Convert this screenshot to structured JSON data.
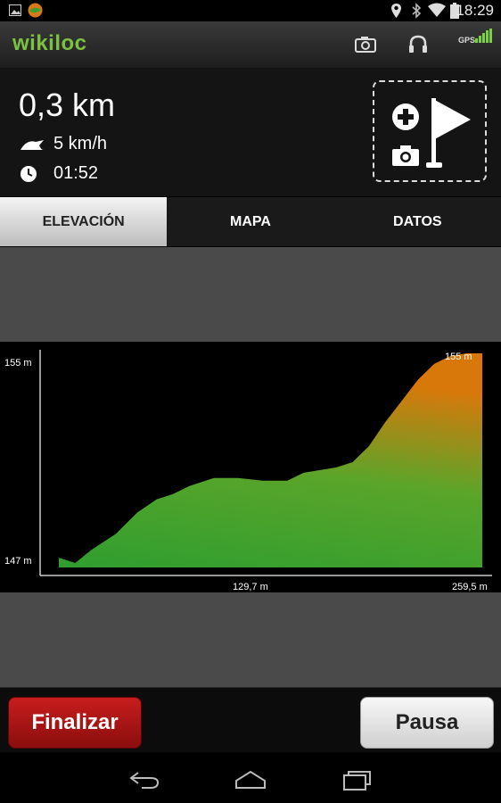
{
  "status_bar": {
    "time": "18:29"
  },
  "app_bar": {
    "logo": "wikiloc",
    "gps_label": "GPS",
    "icons": [
      "camera-icon",
      "headphones-icon",
      "gps-signal-icon"
    ]
  },
  "stats": {
    "distance": "0,3 km",
    "speed": "5 km/h",
    "time": "01:52",
    "add_waypoint_icons": [
      "plus-icon",
      "camera-icon",
      "flag-icon"
    ]
  },
  "tabs": [
    {
      "label": "ELEVACIÓN",
      "active": true
    },
    {
      "label": "MAPA",
      "active": false
    },
    {
      "label": "DATOS",
      "active": false
    }
  ],
  "chart_data": {
    "type": "area",
    "y_tick_labels": [
      "155 m",
      "147 m"
    ],
    "x_tick_labels": [
      "129,7 m",
      "259,5 m"
    ],
    "max_label": "155 m",
    "ylim": [
      147,
      155
    ],
    "xlim": [
      0,
      259.5
    ],
    "x": [
      0,
      10,
      20,
      35,
      48,
      60,
      70,
      80,
      95,
      110,
      125,
      140,
      150,
      160,
      170,
      180,
      190,
      200,
      210,
      220,
      230,
      240,
      250,
      259.5
    ],
    "y": [
      147.3,
      147.1,
      147.6,
      148.2,
      149.0,
      149.5,
      149.7,
      150.0,
      150.3,
      150.3,
      150.2,
      150.2,
      150.5,
      150.6,
      150.7,
      150.9,
      151.5,
      152.4,
      153.2,
      154.0,
      154.6,
      154.9,
      155.0,
      155.0
    ],
    "colors": {
      "low": "#2f9e2f",
      "high": "#d9780a"
    }
  },
  "buttons": {
    "finish": "Finalizar",
    "pause": "Pausa"
  },
  "nav_bar": {
    "icons": [
      "back-icon",
      "home-icon",
      "recents-icon"
    ]
  }
}
